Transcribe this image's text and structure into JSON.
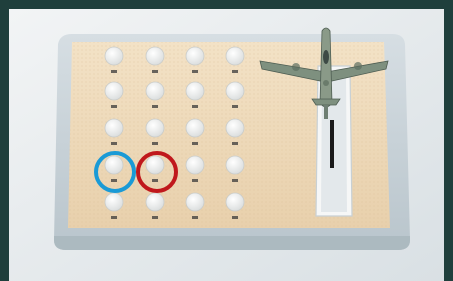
{
  "scene": {
    "description_free": true,
    "highlights": {
      "blue": "#1a9ad6",
      "red": "#c0181c"
    },
    "colors": {
      "outer_frame": "#1f3f3c",
      "backdrop": "#e4e8ea",
      "base_plate": "#cdd6dc",
      "panel": "#eedcc0",
      "peg": "#f4f4f2",
      "aircraft": "#7d8f7f",
      "slot_track": "#1a1a1a"
    }
  },
  "grid": {
    "columns": 4,
    "rows": 5,
    "blue_highlight": {
      "row": 4,
      "col": 1
    },
    "red_highlight": {
      "row": 4,
      "col": 2
    }
  }
}
